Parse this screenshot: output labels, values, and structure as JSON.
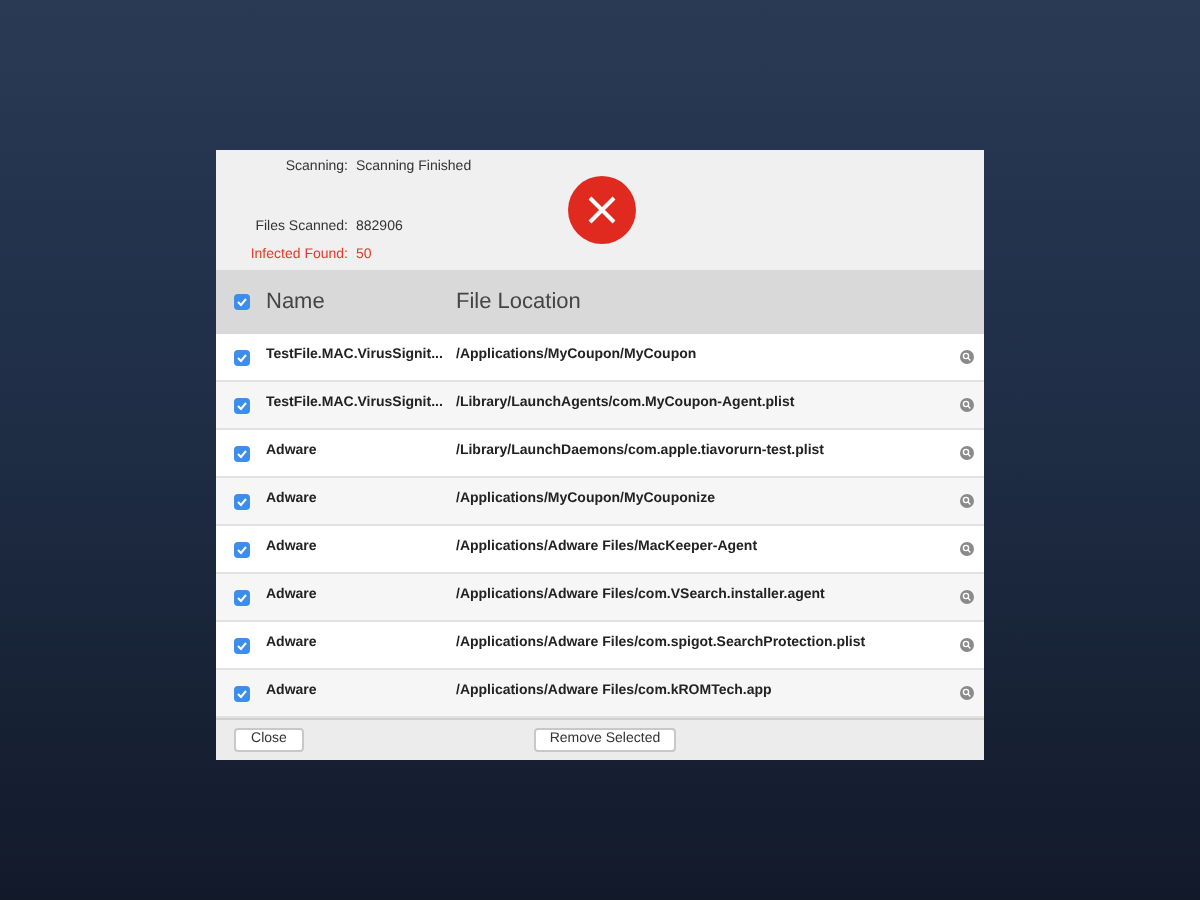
{
  "scan": {
    "status_label": "Scanning:",
    "status_value": "Scanning Finished",
    "files_label": "Files Scanned:",
    "files_value": "882906",
    "infected_label": "Infected Found:",
    "infected_value": "50"
  },
  "table": {
    "header_checked": true,
    "columns": [
      "Name",
      "File Location"
    ],
    "rows": [
      {
        "checked": true,
        "name": "TestFile.MAC.VirusSignit...",
        "location": "/Applications/MyCoupon/MyCoupon"
      },
      {
        "checked": true,
        "name": "TestFile.MAC.VirusSignit...",
        "location": "/Library/LaunchAgents/com.MyCoupon-Agent.plist"
      },
      {
        "checked": true,
        "name": "Adware",
        "location": "/Library/LaunchDaemons/com.apple.tiavorurn-test.plist"
      },
      {
        "checked": true,
        "name": "Adware",
        "location": "/Applications/MyCoupon/MyCouponize"
      },
      {
        "checked": true,
        "name": "Adware",
        "location": "/Applications/Adware Files/MacKeeper-Agent"
      },
      {
        "checked": true,
        "name": "Adware",
        "location": "/Applications/Adware Files/com.VSearch.installer.agent"
      },
      {
        "checked": true,
        "name": "Adware",
        "location": "/Applications/Adware Files/com.spigot.SearchProtection.plist"
      },
      {
        "checked": true,
        "name": "Adware",
        "location": "/Applications/Adware Files/com.kROMTech.app"
      }
    ]
  },
  "buttons": {
    "close": "Close",
    "remove": "Remove Selected"
  }
}
